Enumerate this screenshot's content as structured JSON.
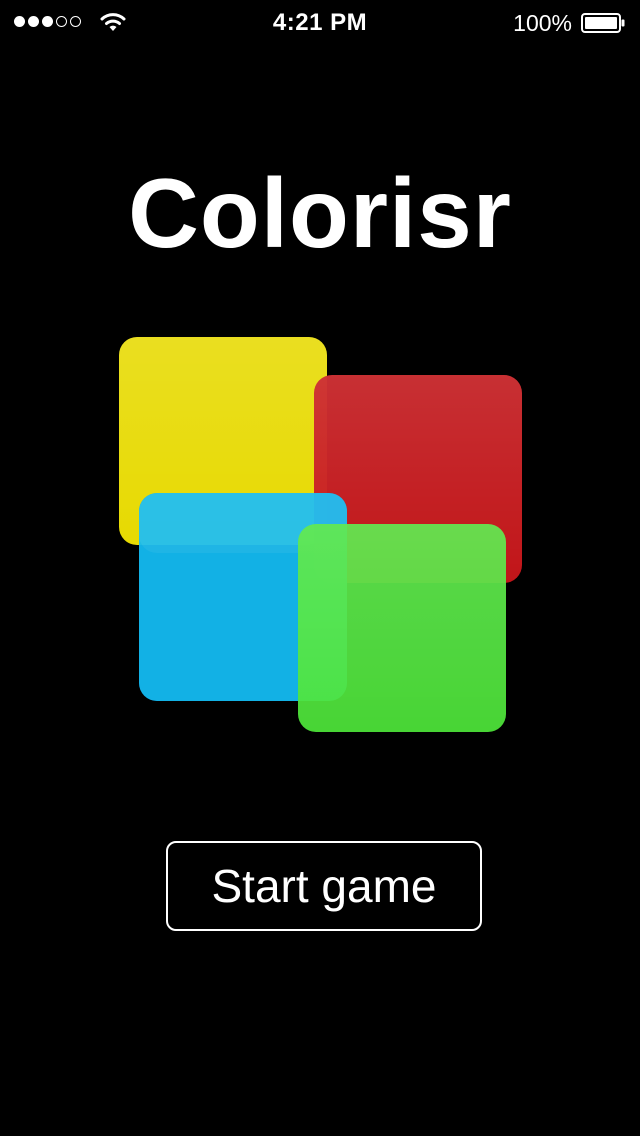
{
  "status_bar": {
    "signal": [
      "filled",
      "filled",
      "filled",
      "empty",
      "empty"
    ],
    "wifi_icon": "wifi-icon",
    "time": "4:21 PM",
    "battery_percent": "100%",
    "battery_icon": "battery-icon"
  },
  "app": {
    "title": "Colorisr"
  },
  "logo": {
    "colors": {
      "yellow": "#e7da02",
      "red": "#c8161a",
      "blue": "#0088e4",
      "green": "#4ee63a"
    }
  },
  "actions": {
    "start_label": "Start game"
  }
}
